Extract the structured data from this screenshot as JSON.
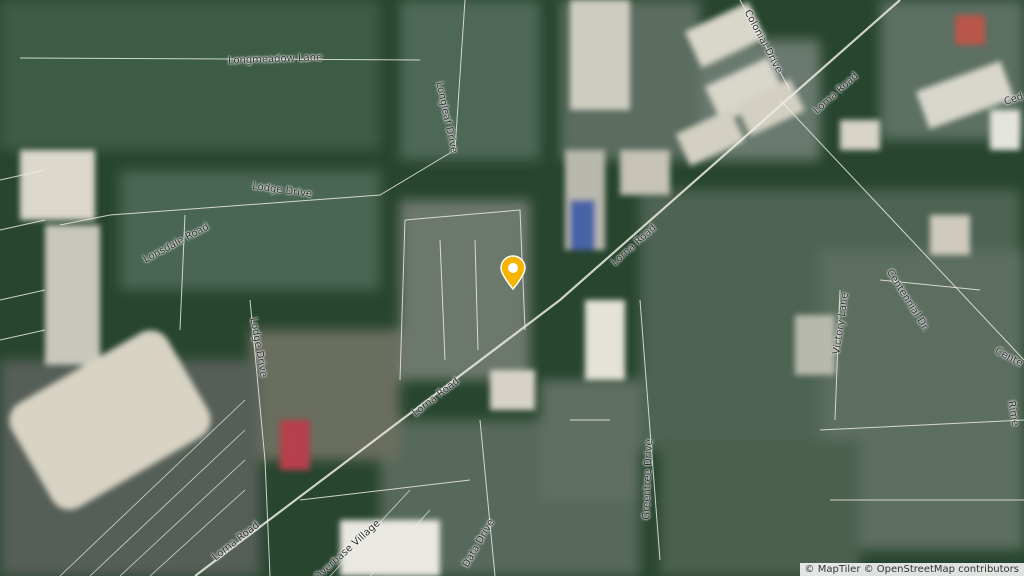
{
  "map": {
    "type": "satellite-with-streets",
    "palette": {
      "vegetation_dark": "#1d3a26",
      "vegetation_mid": "#3b5a43",
      "residential": "#6e7f74",
      "roof_light": "#d6d2c6",
      "road_line": "#e6e6dc",
      "pin": "#f5b400"
    }
  },
  "labels": {
    "longmeadow_lane": "Longmeadow Lane",
    "longleaf_drive": "Longleaf Drive",
    "colonial_drive": "Colonial Drive",
    "lorna_road_ne": "Lorna Road",
    "lorna_road_mid": "Lorna Road",
    "lorna_road_sw": "Lorna Road",
    "lorna_road_far_sw": "Lorna Road",
    "lodge_drive_north": "Lodge Drive",
    "lodge_drive_south": "Lodge Drive",
    "lonsdale_road": "Lonsdale Road",
    "centennial_dr": "Centennial Dr.",
    "centennial_east": "Cente",
    "victory_lane": "Victory Lane",
    "greentree_drive": "Greentree Drive",
    "data_drive": "Data Drive",
    "overbase_village": "Overbase Village",
    "cedar_partial": "Ced",
    "rime_partial": "Rime"
  },
  "marker": {
    "icon": "location-pin-icon",
    "color": "#f5b400"
  },
  "attribution": {
    "maptiler": "© MapTiler",
    "osm": "© OpenStreetMap contributors"
  }
}
